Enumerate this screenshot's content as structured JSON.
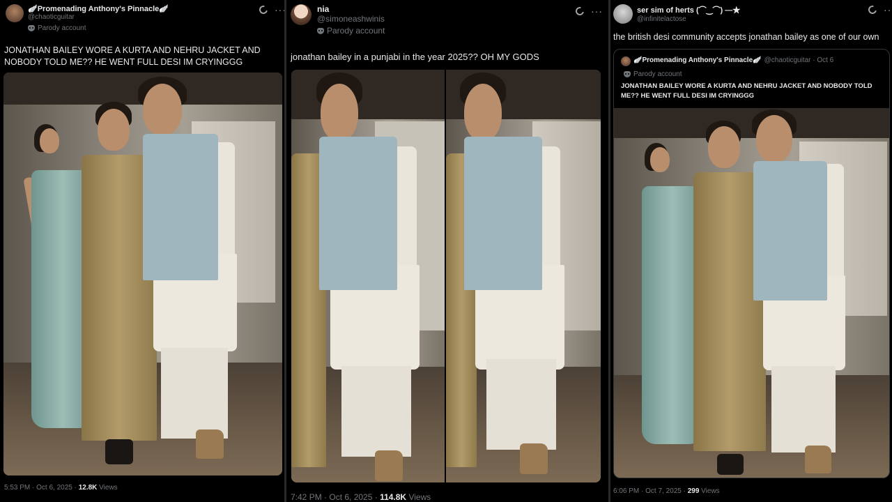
{
  "panels": [
    {
      "author": {
        "name": "🪽Promenading Anthony's Pinnacle🪽",
        "handle": "@chaoticguitar",
        "badge": "Parody account"
      },
      "text": "JONATHAN BAILEY WORE A KURTA AND NEHRU JACKET AND NOBODY TOLD ME?? HE WENT FULL DESI IM CRYINGGG",
      "time": "5:53 PM · Oct 6, 2025 · ",
      "views_count": "12.8K",
      "views_label": " Views"
    },
    {
      "author": {
        "name": "nia",
        "handle": "@simoneashwinis",
        "badge": "Parody account"
      },
      "text": "jonathan bailey in a punjabi in the year 2025?? OH MY GODS",
      "time": "7:42 PM · Oct 6, 2025 · ",
      "views_count": "114.8K",
      "views_label": " Views"
    },
    {
      "author": {
        "name": "ser sim of herts (⌒‿⌒) ―★",
        "handle": "@infinitelactose"
      },
      "text": "the british desi community accepts jonathan bailey as one of our own",
      "quote": {
        "name": "🪽Promenading Anthony's Pinnacle🪽",
        "handle": "@chaoticguitar · Oct 6",
        "badge": "Parody account",
        "text": "JONATHAN BAILEY WORE A KURTA AND NEHRU JACKET AND NOBODY TOLD ME?? HE WENT FULL DESI IM CRYINGGG"
      },
      "time": "6:06 PM · Oct 7, 2025 · ",
      "views_count": "299",
      "views_label": " Views"
    }
  ],
  "icons": {
    "grok": "grok-icon",
    "more": "more-icon",
    "parody": "mask-icon"
  },
  "colors": {
    "bg": "#000000",
    "text": "#e7e9ea",
    "muted": "#71767b",
    "jacket": "#9fb6be",
    "dress": "#9dbdb5"
  }
}
